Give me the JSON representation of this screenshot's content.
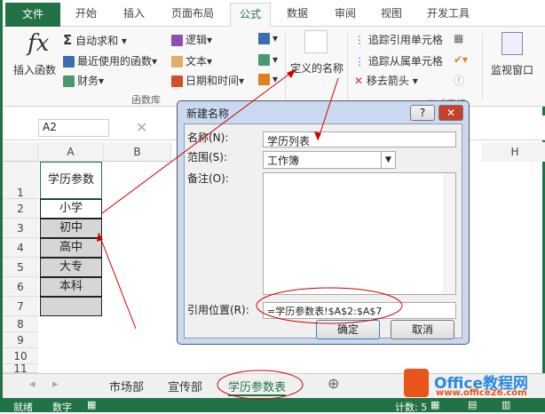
{
  "tabs": [
    "文件",
    "开始",
    "插入",
    "页面布局",
    "公式",
    "数据",
    "审阅",
    "视图",
    "开发工具"
  ],
  "ribbon": {
    "insert_function": "插入函数",
    "fx": "fx",
    "autosum": "自动求和",
    "recent": "最近使用的函数",
    "finance": "财务",
    "logic": "逻辑",
    "text": "文本",
    "datetime": "日期和时间",
    "group_library": "函数库",
    "defined_names": "定义的名称",
    "trace_precedents": "追踪引用单元格",
    "trace_dependents": "追踪从属单元格",
    "remove_arrows": "移去箭头",
    "group_audit": "公式审核",
    "watch_window": "监视窗口"
  },
  "formula_bar": {
    "name_box": "A2"
  },
  "columns": [
    "A",
    "B",
    "H"
  ],
  "rows": [
    "1",
    "2",
    "3",
    "4",
    "5",
    "6",
    "7",
    "8",
    "9",
    "10",
    "11"
  ],
  "cells": {
    "header": "学历参数",
    "values": [
      "小学",
      "初中",
      "高中",
      "大专",
      "本科",
      ""
    ]
  },
  "dialog": {
    "title": "新建名称",
    "help": "?",
    "close": "✕",
    "name_label": "名称(N):",
    "name_value": "学历列表",
    "scope_label": "范围(S):",
    "scope_value": "工作簿",
    "comment_label": "备注(O):",
    "ref_label": "引用位置(R):",
    "ref_value": "=学历参数表!$A$2:$A$7",
    "ok": "确定",
    "cancel": "取消"
  },
  "sheets": [
    "市场部",
    "宣传部",
    "学历参数表"
  ],
  "status": {
    "ready": "就绪",
    "num": "数字",
    "count": "计数: 5"
  },
  "watermark": {
    "brand": "Office教程网",
    "url": "www.office26.com"
  },
  "colors": {
    "accent": "#217346",
    "annotation": "#d00000"
  }
}
